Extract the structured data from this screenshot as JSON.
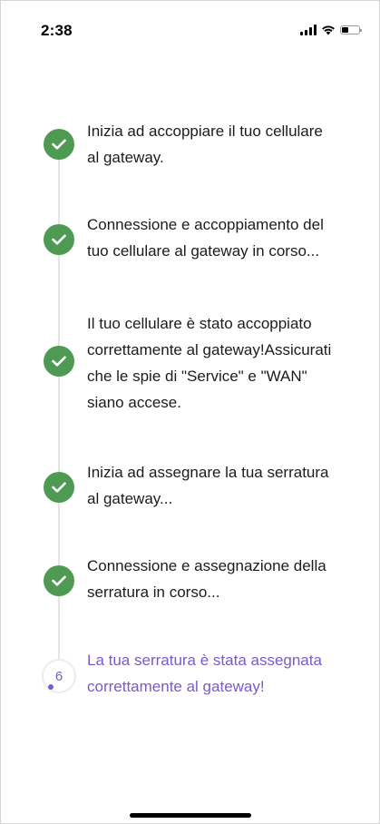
{
  "status_bar": {
    "time": "2:38",
    "icons": [
      "cellular-signal-icon",
      "wifi-icon",
      "battery-icon"
    ]
  },
  "steps": [
    {
      "status": "completed",
      "icon": "checkmark-icon",
      "text": "Inizia ad accoppiare il tuo cellulare\nal gateway."
    },
    {
      "status": "completed",
      "icon": "checkmark-icon",
      "text": "Connessione e accoppiamento del\ntuo cellulare al gateway in corso..."
    },
    {
      "status": "completed",
      "icon": "checkmark-icon",
      "text": "Il tuo cellulare è stato accoppiato\ncorrettamente al gateway!Assicurati\nche le spie di \"Service\" e \"WAN\"\nsiano accese."
    },
    {
      "status": "completed",
      "icon": "checkmark-icon",
      "text": "Inizia ad assegnare la tua serratura\nal gateway..."
    },
    {
      "status": "completed",
      "icon": "checkmark-icon",
      "text": "Connessione e assegnazione della\nserratura in corso..."
    },
    {
      "status": "in-progress",
      "number": "6",
      "text": "La tua serratura è stata assegnata\ncorrettamente al gateway!"
    }
  ],
  "colors": {
    "completed": "#4e9a52",
    "in_progress": "#7b5ac9",
    "timeline": "#e4e4e7"
  }
}
